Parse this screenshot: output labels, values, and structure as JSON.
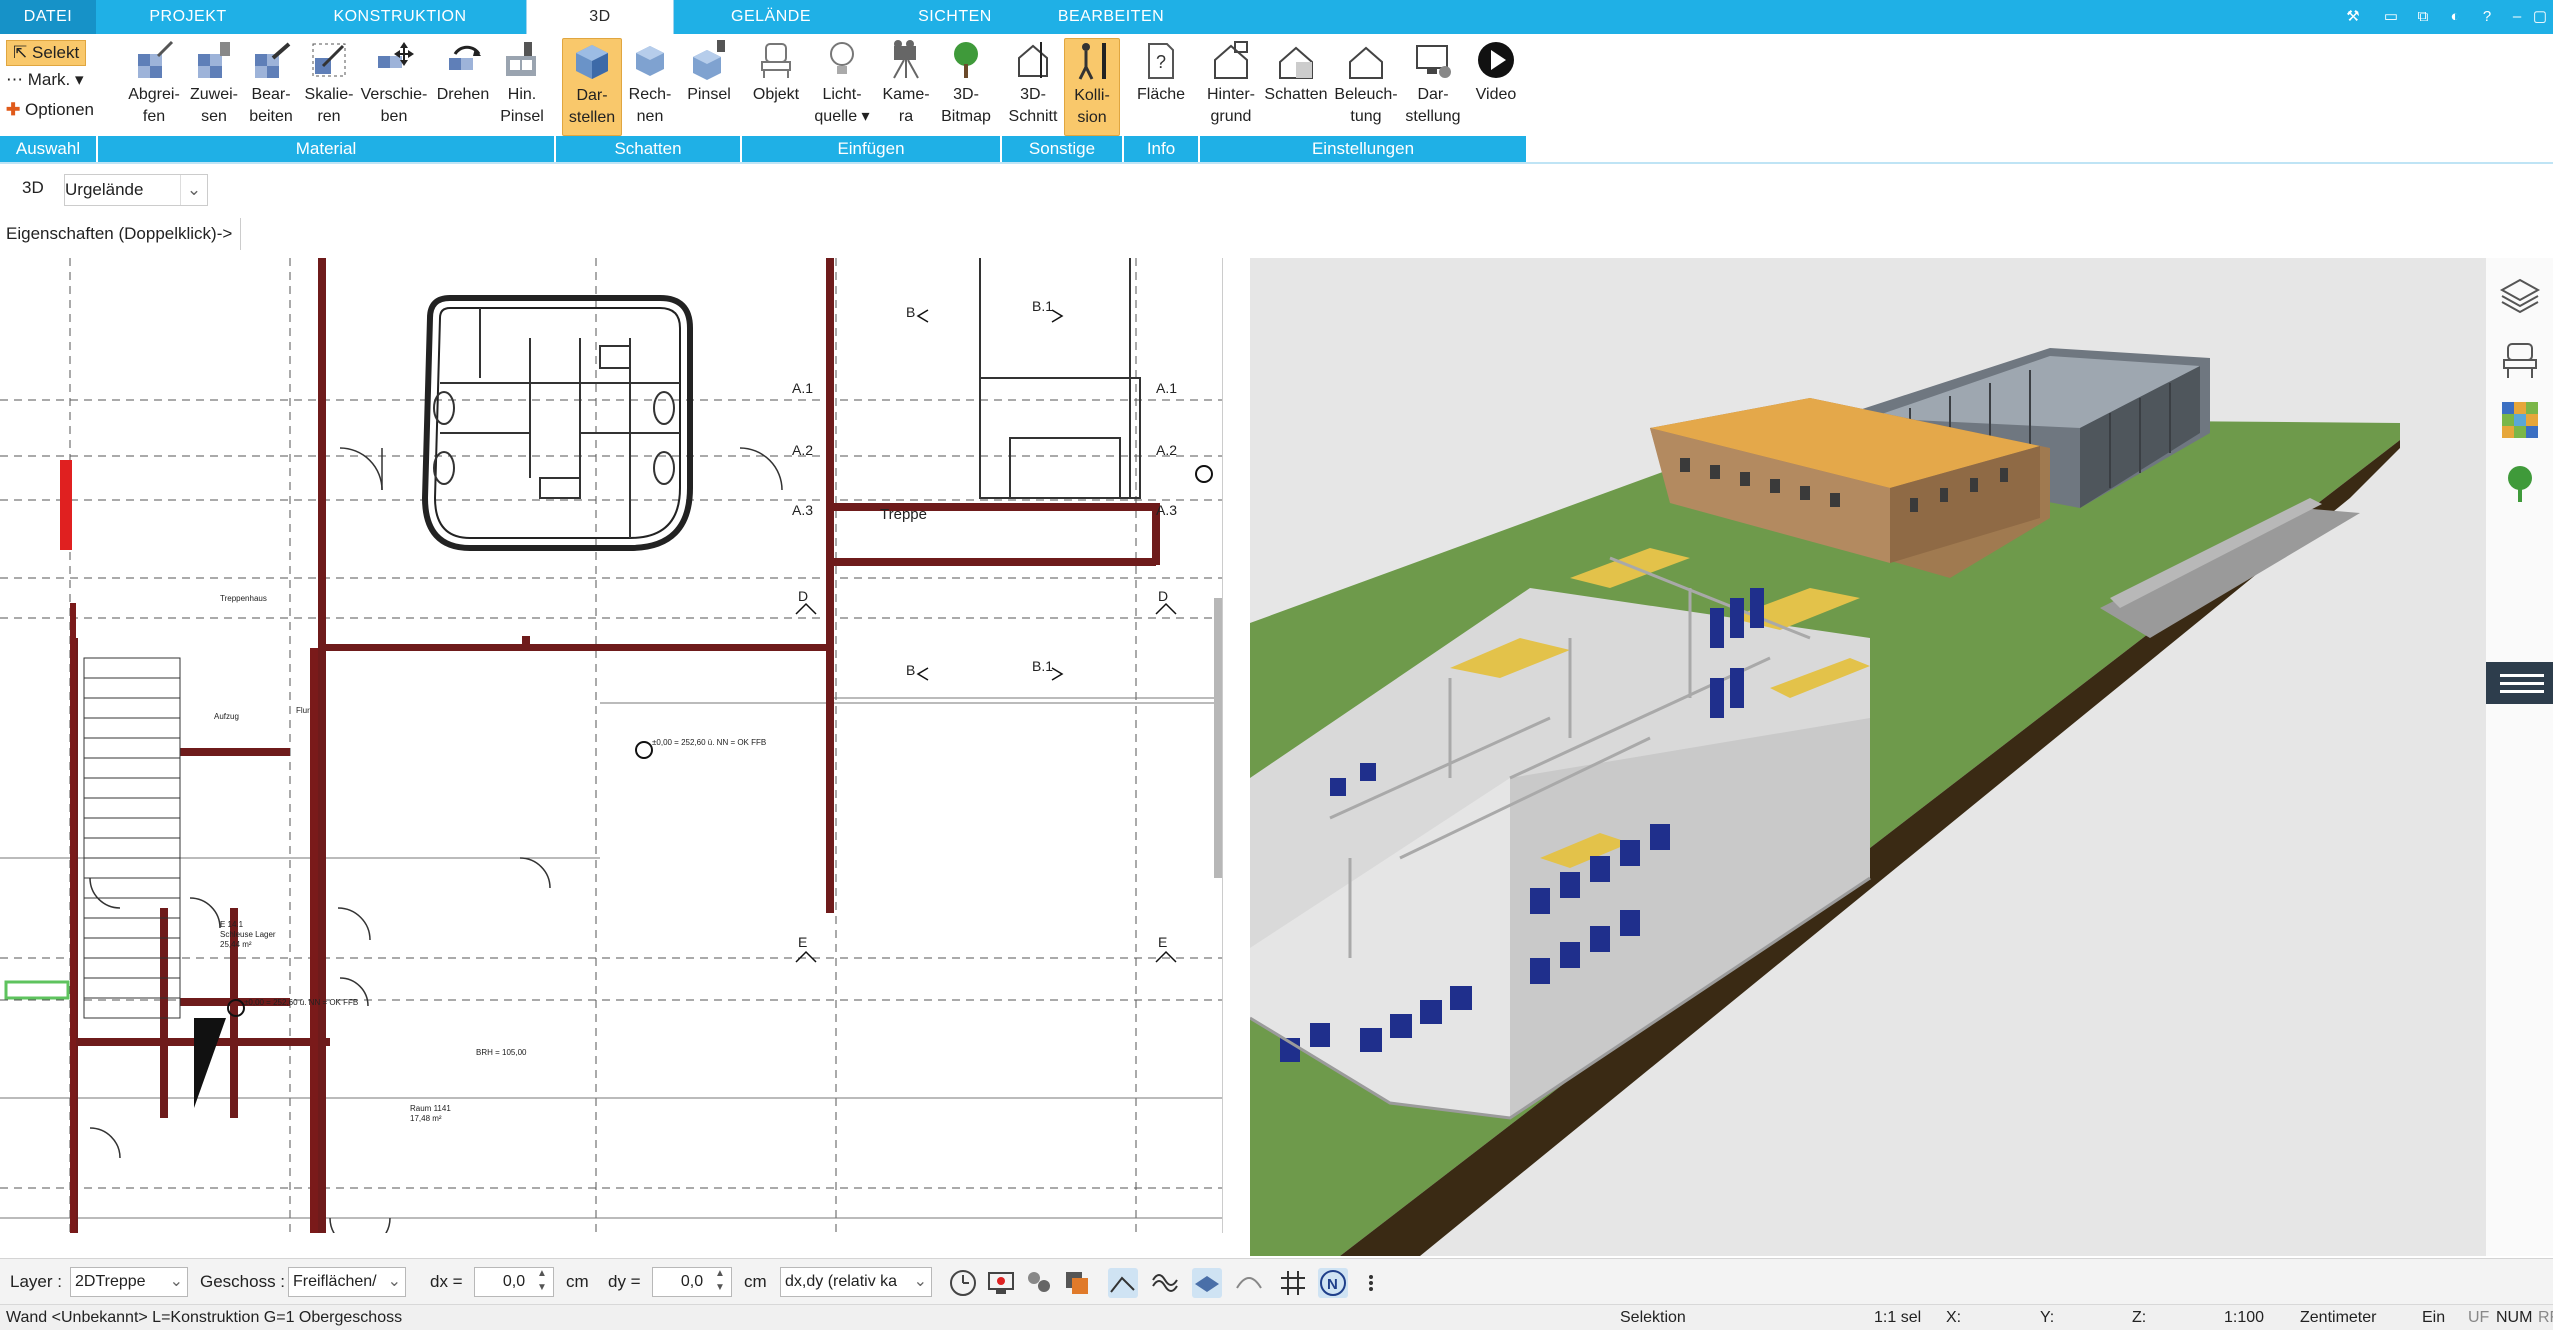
{
  "menu": {
    "tabs": [
      "DATEI",
      "PROJEKT",
      "KONSTRUKTION",
      "3D",
      "GELÄNDE",
      "SICHTEN",
      "BEARBEITEN"
    ],
    "active_index": 3
  },
  "ribbon": {
    "auswahl": {
      "selekt": "Selekt",
      "mark": "Mark.",
      "optionen": "Optionen",
      "group": "Auswahl"
    },
    "material": {
      "group": "Material",
      "buttons": [
        {
          "line1": "Abgrei-",
          "line2": "fen"
        },
        {
          "line1": "Zuwei-",
          "line2": "sen"
        },
        {
          "line1": "Bear-",
          "line2": "beiten"
        },
        {
          "line1": "Skalie-",
          "line2": "ren"
        },
        {
          "line1": "Verschie-",
          "line2": "ben"
        },
        {
          "line1": "Drehen",
          "line2": ""
        },
        {
          "line1": "Hin.",
          "line2": "Pinsel"
        }
      ]
    },
    "schatten": {
      "group": "Schatten",
      "buttons": [
        {
          "line1": "Dar-",
          "line2": "stellen"
        },
        {
          "line1": "Rech-",
          "line2": "nen"
        },
        {
          "line1": "Pinsel",
          "line2": ""
        }
      ]
    },
    "einfuegen": {
      "group": "Einfügen",
      "buttons": [
        {
          "line1": "Objekt",
          "line2": ""
        },
        {
          "line1": "Licht-",
          "line2": "quelle ▾"
        },
        {
          "line1": "Kame-",
          "line2": "ra"
        },
        {
          "line1": "3D-",
          "line2": "Bitmap"
        }
      ]
    },
    "sonstige": {
      "group": "Sonstige",
      "buttons": [
        {
          "line1": "3D-",
          "line2": "Schnitt"
        },
        {
          "line1": "Kolli-",
          "line2": "sion"
        }
      ]
    },
    "info": {
      "group": "Info",
      "buttons": [
        {
          "line1": "Fläche",
          "line2": ""
        }
      ]
    },
    "einstellungen": {
      "group": "Einstellungen",
      "buttons": [
        {
          "line1": "Hinter-",
          "line2": "grund"
        },
        {
          "line1": "Schatten",
          "line2": ""
        },
        {
          "line1": "Beleuch-",
          "line2": "tung"
        },
        {
          "line1": "Dar-",
          "line2": "stellung"
        },
        {
          "line1": "Video",
          "line2": ""
        }
      ]
    }
  },
  "view_selector": {
    "mode": "3D",
    "value": "Urgelände"
  },
  "properties_hint": "Eigenschaften (Doppelklick)->",
  "plan_labels": {
    "treppe": "Treppe",
    "a1": "A.1",
    "a2": "A.2",
    "a3": "A.3",
    "b1": "B.1",
    "b": "B",
    "d": "D",
    "e": "E",
    "level_note": "±0,00 = 252,60 ü. NN = OK FFB",
    "room1": "Raum 1141",
    "room1_area": "17,48 m²",
    "room2": "E 14.1",
    "room2_name": "Schleuse Lager",
    "room2_area": "25,44 m²",
    "brh": "BRH = 105,00",
    "elevator": "Aufzug",
    "flur": "Flur",
    "stair_room": "Treppenhaus"
  },
  "bottom": {
    "layer_label": "Layer :",
    "layer_value": "2DTreppe",
    "geschoss_label": "Geschoss :",
    "geschoss_value": "Freiflächen/",
    "dx_label": "dx =",
    "dx_value": "0,0",
    "dx_unit": "cm",
    "dy_label": "dy =",
    "dy_value": "0,0",
    "dy_unit": "cm",
    "mode_value": "dx,dy (relativ ka"
  },
  "status": {
    "left": "Wand <Unbekannt> L=Konstruktion G=1 Obergeschoss",
    "mode": "Selektion",
    "sel": "1:1 sel",
    "x": "X:",
    "y": "Y:",
    "z": "Z:",
    "scale": "1:100",
    "unit": "Zentimeter",
    "ein": "Ein",
    "uf": "UF",
    "num": "NUM",
    "rf": "RF"
  },
  "colors": {
    "accent": "#1fb0e6",
    "accent_dark": "#1692c8",
    "ground": "#6e9a4b",
    "roof": "#e4a84a",
    "wall_red": "#7a1a1a"
  }
}
